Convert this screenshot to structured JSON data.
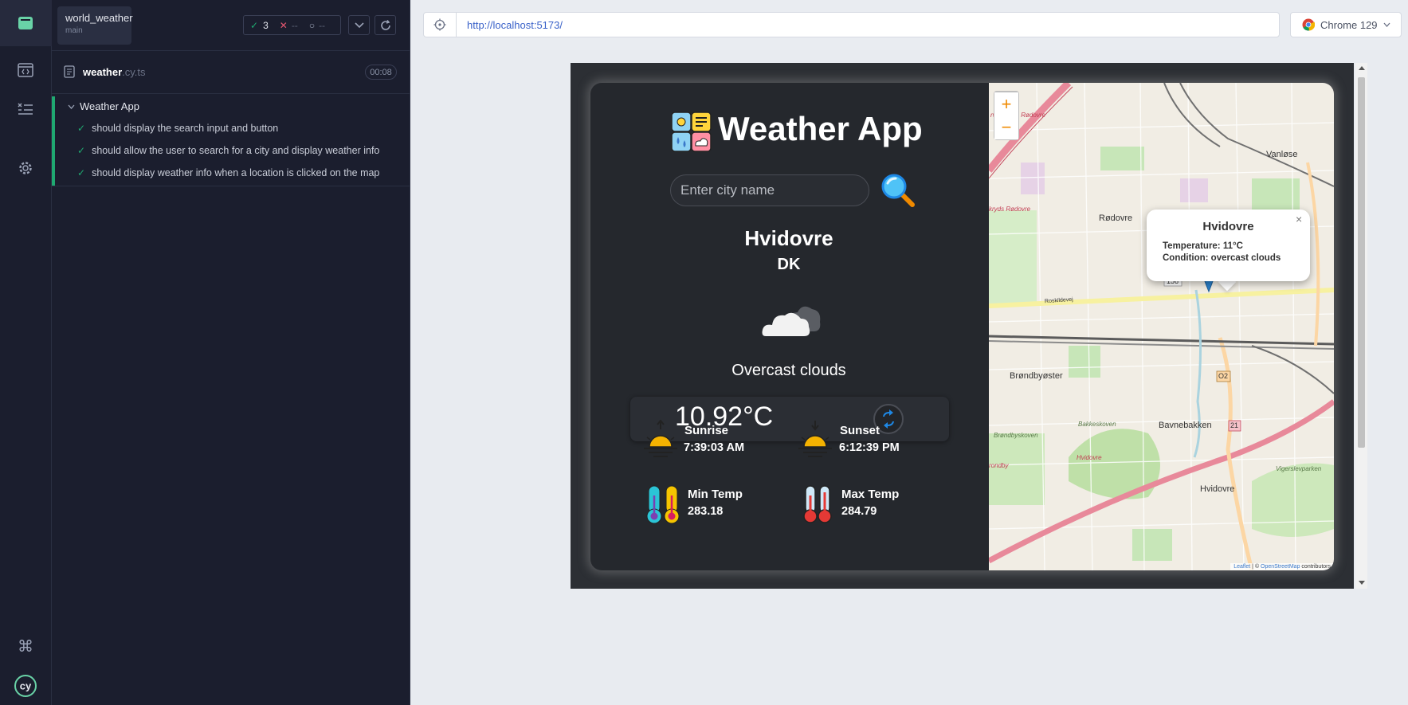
{
  "rail": {
    "icons": [
      "app-window-icon",
      "code-browser-icon",
      "test-list-icon",
      "settings-icon",
      "command-icon",
      "cypress-logo"
    ]
  },
  "reporter": {
    "project_name": "world_weather",
    "branch": "main",
    "passed": "3",
    "failed": "--",
    "pending": "--",
    "spec_name": "weather",
    "spec_ext": ".cy.ts",
    "duration": "00:08",
    "suite_title": "Weather App",
    "tests": [
      {
        "title": "should display the search input and button"
      },
      {
        "title": "should allow the user to search for a city and display weather info"
      },
      {
        "title": "should display weather info when a location is clicked on the map"
      }
    ]
  },
  "browser": {
    "url": "http://localhost:5173/",
    "browser_name": "Chrome 129"
  },
  "app": {
    "title": "Weather App",
    "search_placeholder": "Enter city name",
    "city": "Hvidovre",
    "country": "DK",
    "condition": "Overcast clouds",
    "temperature": "10.92°C",
    "sunrise_label": "Sunrise",
    "sunrise_time": "7:39:03 AM",
    "sunset_label": "Sunset",
    "sunset_time": "6:12:39 PM",
    "min_temp_label": "Min Temp",
    "min_temp": "283.18",
    "max_temp_label": "Max Temp",
    "max_temp": "284.79"
  },
  "map": {
    "zoom_in": "+",
    "zoom_out": "−",
    "popup_title": "Hvidovre",
    "popup_temperature": "Temperature: 11°C",
    "popup_condition": "Condition: overcast clouds",
    "popup_close": "×",
    "labels": {
      "vanlose": "Vanløse",
      "rodovre_north": "Rødovre",
      "brondbyoster": "Brøndbyøster",
      "bavnebakken": "Bavnebakken",
      "hvidovre_town": "Hvidovre",
      "bakkeskoven": "Bakkeskoven",
      "brondbyskoven": "Brøndbyskoven",
      "vigerslevparken": "Vigerslevparken",
      "roskildevej": "Roskildevej",
      "road_156": "156",
      "road_o2": "O2",
      "road_21": "21",
      "road_rodovre": "rvejskryds Rødovre",
      "road_rodovre2": "kryds Rødovre",
      "road_hvidovre": "Hvidovre",
      "road_brondby": "rondby"
    },
    "attribution_leaflet": "Leaflet",
    "attribution_osm": "OpenStreetMap",
    "attribution_rest": "contributors"
  },
  "colors": {
    "pass_green": "#1fa971",
    "fail_red": "#e45770",
    "accent_orange": "#f08a00",
    "marker_blue": "#2a81cb"
  }
}
